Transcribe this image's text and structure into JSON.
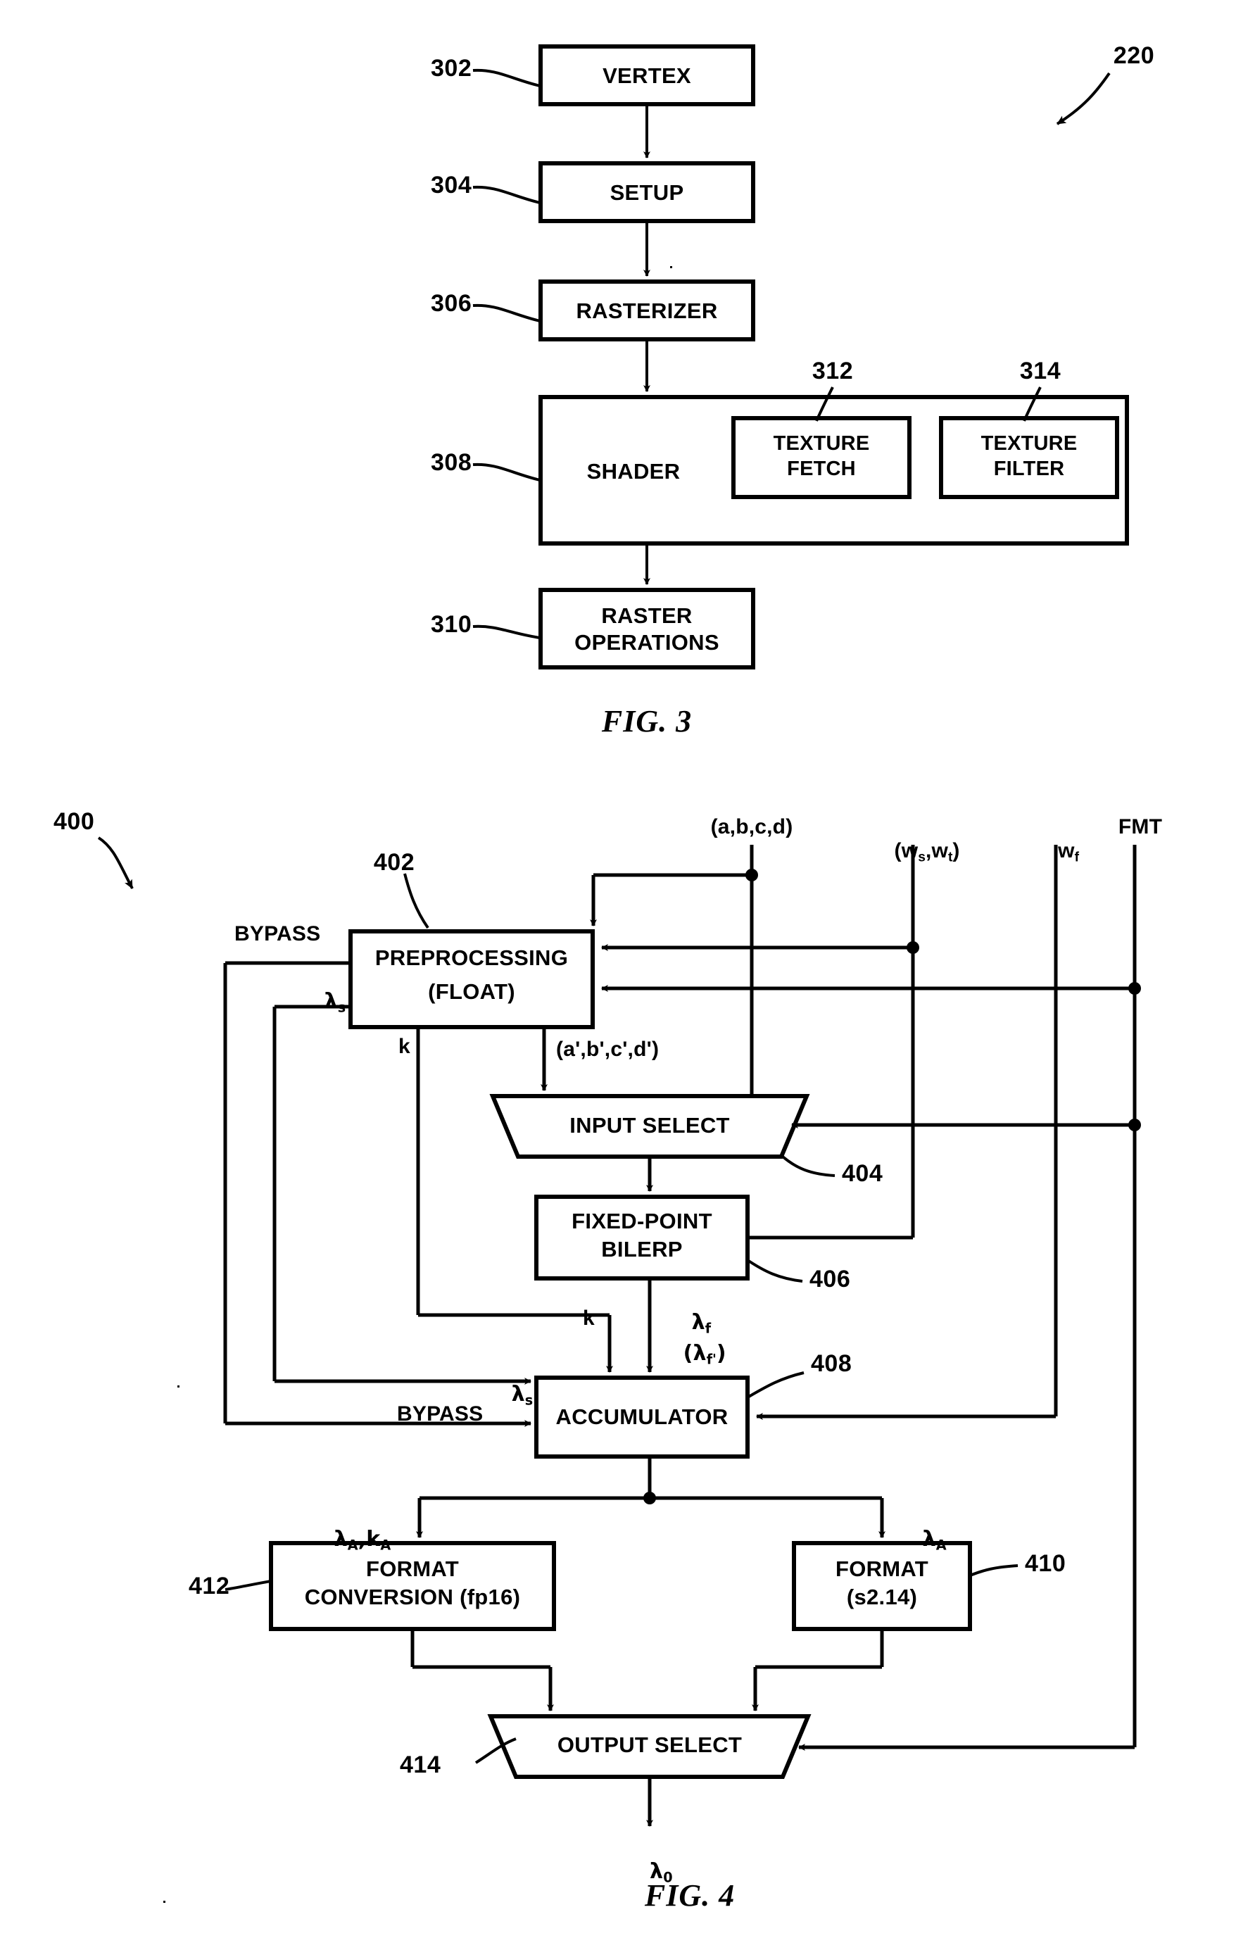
{
  "figure3": {
    "ref_top": "220",
    "caption": "FIG. 3",
    "blocks": [
      {
        "ref": "302",
        "label": "VERTEX"
      },
      {
        "ref": "304",
        "label": "SETUP"
      },
      {
        "ref": "306",
        "label": "RASTERIZER"
      },
      {
        "ref": "308",
        "label": "SHADER"
      },
      {
        "ref": "310",
        "label_line1": "RASTER",
        "label_line2": "OPERATIONS"
      }
    ],
    "shader_children": [
      {
        "ref": "312",
        "label_line1": "TEXTURE",
        "label_line2": "FETCH"
      },
      {
        "ref": "314",
        "label_line1": "TEXTURE",
        "label_line2": "FILTER"
      }
    ]
  },
  "figure4": {
    "ref_top": "400",
    "caption": "FIG. 4",
    "inputs": [
      {
        "name": "abcd",
        "label": "(a,b,c,d)"
      },
      {
        "name": "ws-wt",
        "label": "(w",
        "sub1": "s",
        "mid": ",w",
        "sub2": "t",
        "end": ")"
      },
      {
        "name": "wf",
        "label": "w",
        "sub": "f"
      },
      {
        "name": "fmt",
        "label": "FMT"
      }
    ],
    "blocks": [
      {
        "ref": "402",
        "label_line1": "PREPROCESSING",
        "label_line2": "(FLOAT)"
      },
      {
        "ref": "404",
        "label": "INPUT SELECT"
      },
      {
        "ref": "406",
        "label_line1": "FIXED-POINT",
        "label_line2": "BILERP"
      },
      {
        "ref": "408",
        "label": "ACCUMULATOR"
      },
      {
        "ref": "410",
        "label_line1": "FORMAT",
        "label_line2": "(s2.14)"
      },
      {
        "ref": "412",
        "label_line1": "FORMAT",
        "label_line2": "CONVERSION (fp16)"
      },
      {
        "ref": "414",
        "label": "OUTPUT SELECT"
      }
    ],
    "signals": {
      "bypass_top": "BYPASS",
      "bypass_bottom": "BYPASS",
      "lambda_s_top": "λ",
      "lambda_s_top_sub": "s",
      "lambda_s_mid": "λ",
      "lambda_s_mid_sub": "s",
      "k_upper": "k",
      "k_lower": "k",
      "abcd_primed": "(a',b',c',d')",
      "lambda_f": "λ",
      "lambda_f_sub": "f",
      "lambda_f_primed": "(λ",
      "lambda_f_primed_sub": "f'",
      "lambda_f_primed_end": ")",
      "lambda_A_kA": "λ",
      "lambda_A_kA_sub1": "A",
      "lambda_A_kA_mid": ",k",
      "lambda_A_kA_sub2": "A",
      "lambda_A": "λ",
      "lambda_A_sub": "A",
      "lambda_out": "λ",
      "lambda_out_sub": "0"
    }
  }
}
